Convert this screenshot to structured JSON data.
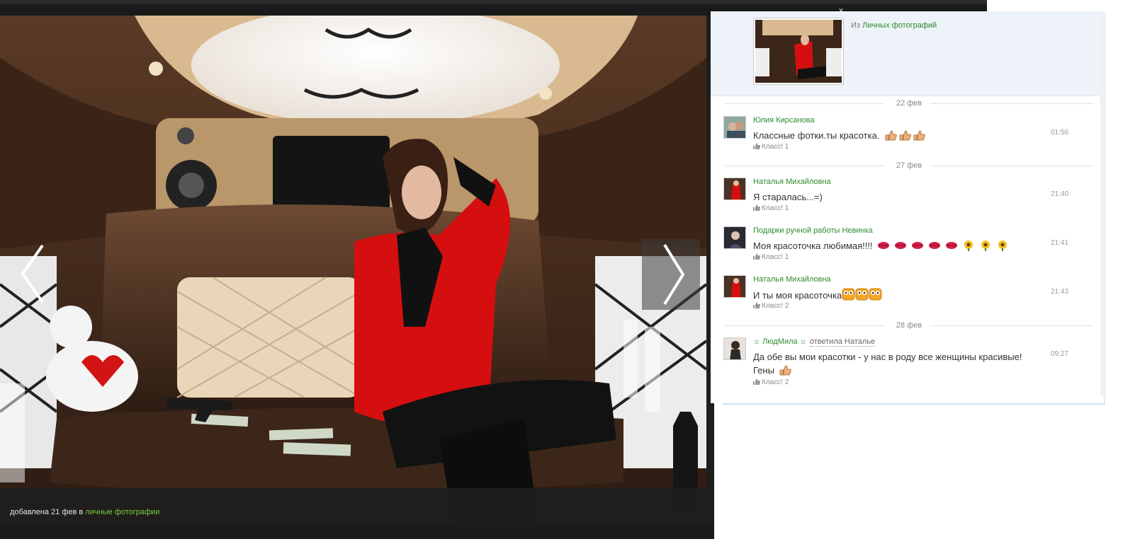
{
  "viewer": {
    "caption_prefix": "добавлена 21 фев в ",
    "caption_link": "личные фотографии",
    "prev_icon": "chevron-left-icon",
    "next_icon": "chevron-right-icon",
    "close_icon": "close-icon",
    "close_symbol": "×"
  },
  "panel": {
    "from_prefix": "Из ",
    "from_link": "Личных фотографий"
  },
  "dates": [
    "22 фев",
    "27 фев",
    "28 фев"
  ],
  "comments": [
    {
      "author": "Юлия Кирсанова",
      "reply": "",
      "text": "Классные фотки.ты красотка.",
      "time": "01:56",
      "likes": "Класс! 1",
      "emoji": "thumbs-up-icon",
      "emoji_count": 3
    },
    {
      "author": "Наталья Михайловна",
      "reply": "",
      "text": "Я старалась...=)",
      "time": "21:40",
      "likes": "Класс! 1",
      "emoji": "",
      "emoji_count": 0
    },
    {
      "author": "Подарки ручной работы Невинка",
      "reply": "",
      "text": "Моя красоточка любимая!!!!",
      "time": "21:41",
      "likes": "Класс! 1",
      "emoji": "lips-and-sunflower-icons",
      "emoji_count": 8
    },
    {
      "author": "Наталья Михайловна",
      "reply": "",
      "text": "И ты моя красоточка",
      "time": "21:43",
      "likes": "Класс! 2",
      "emoji": "smiley-face-icon",
      "emoji_count": 3
    },
    {
      "author": "☼ ЛюдМила ☼",
      "reply": "ответила Наталье",
      "text": "Да обе вы мои красотки - у нас в роду все женщины красивые! Гены",
      "time": "09:27",
      "likes": "Класс! 2",
      "emoji": "thumbs-up-icon",
      "emoji_count": 1
    }
  ],
  "colors": {
    "link": "#2e8b2e",
    "caption_link": "#7ccd3f",
    "panel_head_bg": "#edf3f8"
  }
}
